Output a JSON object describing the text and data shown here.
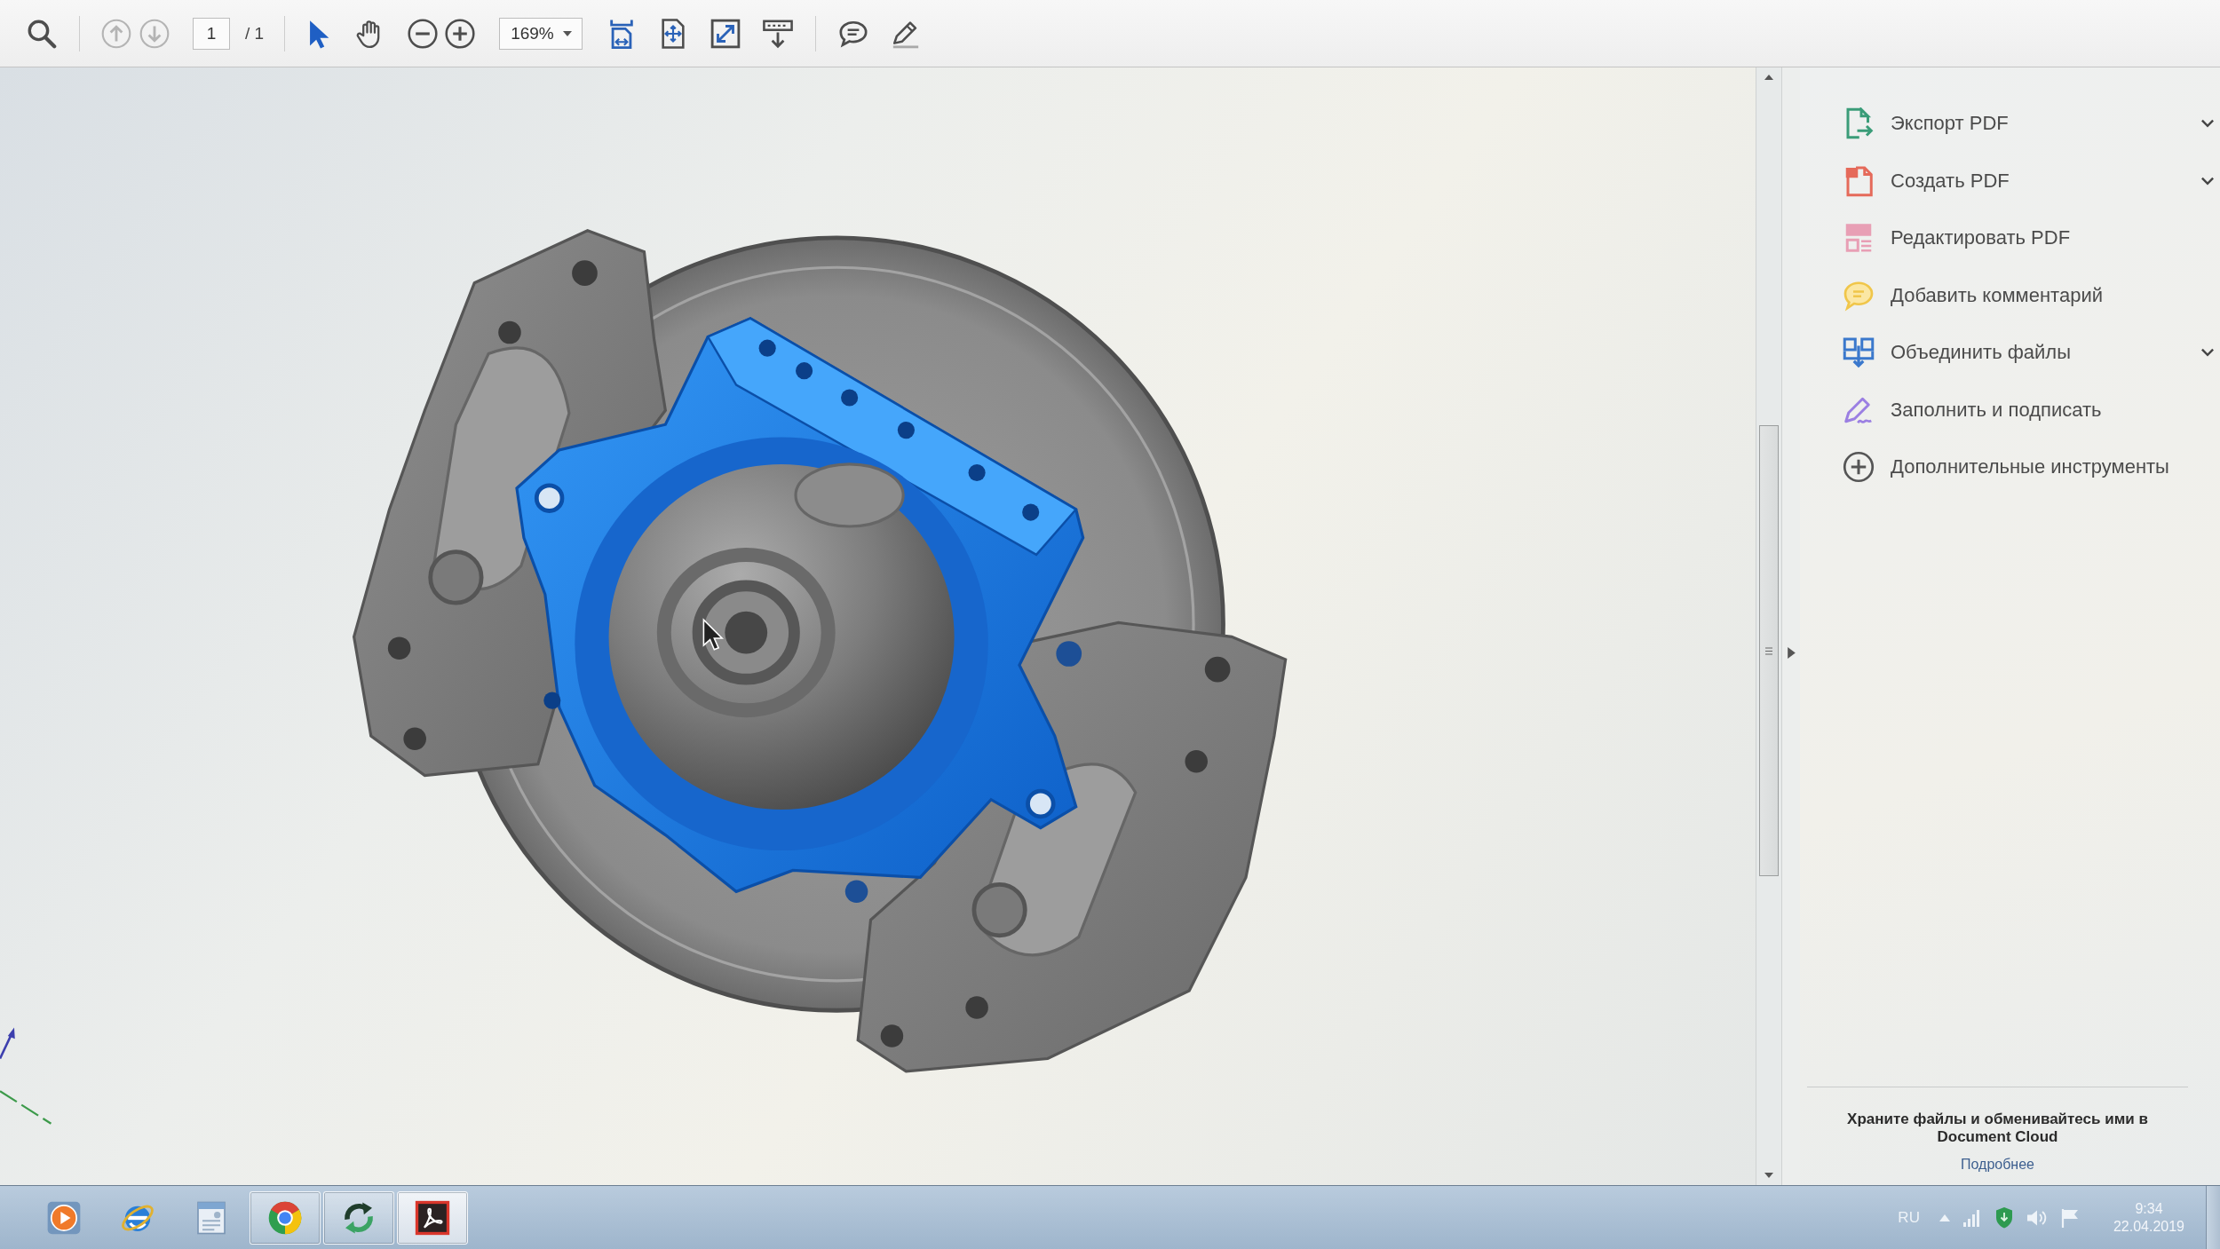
{
  "toolbar": {
    "page_nav": [
      {
        "kind": "previous",
        "disabled": true
      },
      {
        "kind": "next",
        "disabled": true
      }
    ],
    "page_number": "1",
    "page_total": "/ 1",
    "tools": [
      {
        "kind": "select",
        "selected": true
      },
      {
        "kind": "hand",
        "selected": false
      }
    ],
    "zoom": "169%"
  },
  "tools_pane": {
    "items": [
      {
        "kind": "export",
        "label": "Экспорт PDF",
        "expandable": true
      },
      {
        "kind": "create",
        "label": "Создать PDF",
        "expandable": true
      },
      {
        "kind": "edit",
        "label": "Редактировать PDF",
        "expandable": false
      },
      {
        "kind": "comment",
        "label": "Добавить комментарий",
        "expandable": false
      },
      {
        "kind": "combine",
        "label": "Объединить файлы",
        "expandable": true
      },
      {
        "kind": "sign",
        "label": "Заполнить и подписать",
        "expandable": false
      },
      {
        "kind": "more",
        "label": "Дополнительные инструменты",
        "expandable": false
      }
    ],
    "promo": {
      "text": "Храните файлы и обменивайтесь ими в Document Cloud",
      "link": "Подробнее"
    }
  },
  "taskbar": {
    "apps": [
      {
        "kind": "media",
        "running": false,
        "selected": false
      },
      {
        "kind": "ie",
        "running": false,
        "selected": false
      },
      {
        "kind": "window",
        "running": false,
        "selected": false
      },
      {
        "kind": "chrome",
        "running": true,
        "selected": false
      },
      {
        "kind": "sync",
        "running": true,
        "selected": false
      },
      {
        "kind": "acrobat",
        "running": true,
        "selected": true
      }
    ],
    "tray": {
      "language": "RU",
      "time": "9:34",
      "date": "22.04.2019"
    }
  }
}
